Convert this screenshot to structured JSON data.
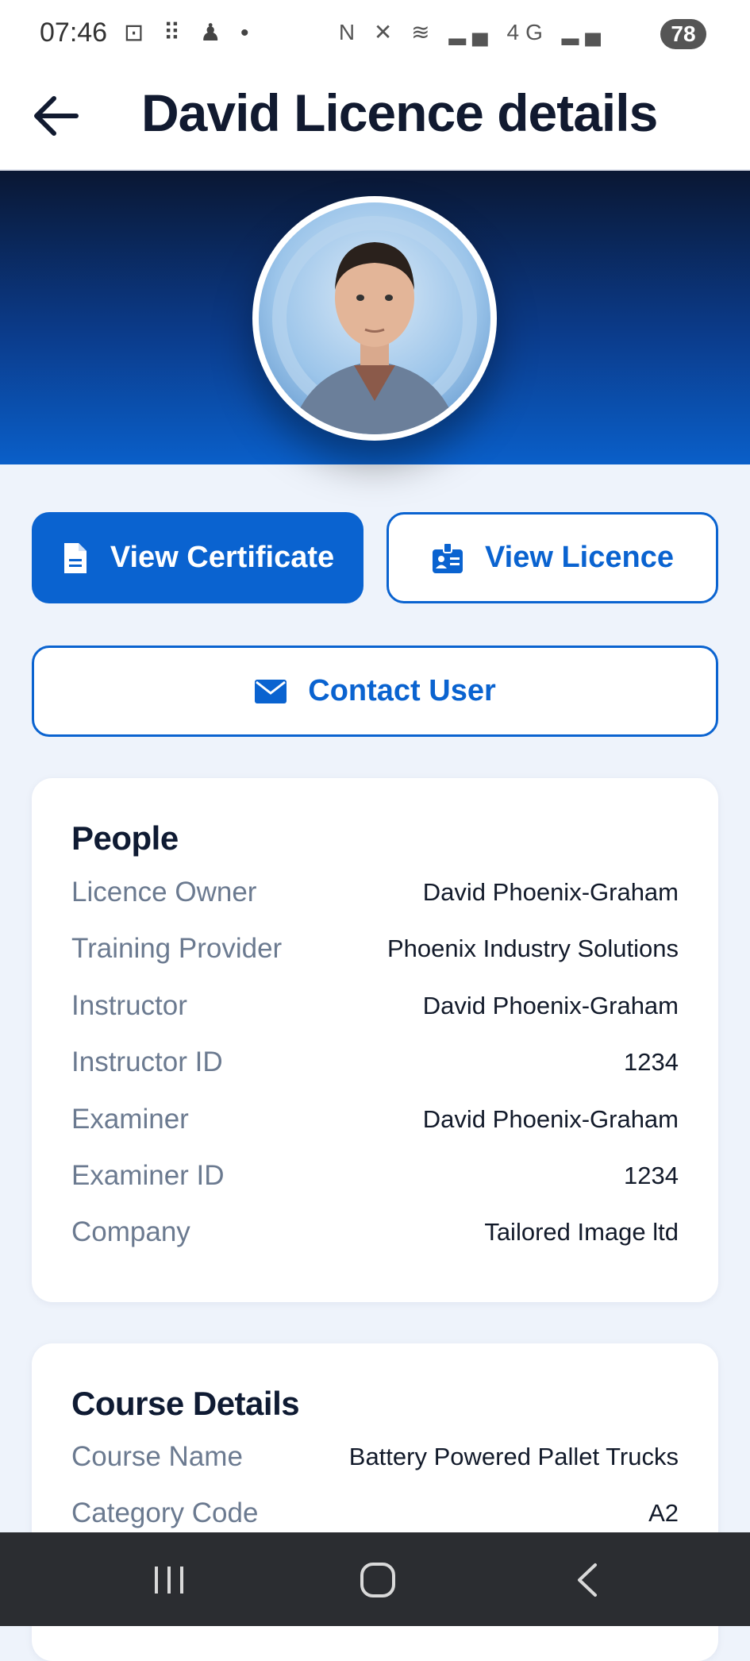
{
  "status_bar": {
    "time": "07:46",
    "left_icons": "⊡ ⠿ ♟ •",
    "right_icons": "N ✕ ≋ ▂▄ 4G ▂▄",
    "battery": "78"
  },
  "header": {
    "title": "David Licence details"
  },
  "colors": {
    "primary": "#0a63d0",
    "hero_top": "#0a1733",
    "hero_bottom": "#0a5fc9"
  },
  "actions": {
    "view_certificate": "View Certificate",
    "view_licence": "View Licence",
    "contact_user": "Contact User"
  },
  "people": {
    "title": "People",
    "rows": [
      {
        "label": "Licence Owner",
        "value": "David Phoenix-Graham"
      },
      {
        "label": "Training Provider",
        "value": "Phoenix Industry Solutions"
      },
      {
        "label": "Instructor",
        "value": "David Phoenix-Graham"
      },
      {
        "label": "Instructor ID",
        "value": "1234"
      },
      {
        "label": "Examiner",
        "value": "David Phoenix-Graham"
      },
      {
        "label": "Examiner ID",
        "value": "1234"
      },
      {
        "label": "Company",
        "value": "Tailored Image ltd"
      }
    ]
  },
  "course": {
    "title": "Course Details",
    "rows": [
      {
        "label": "Course Name",
        "value": "Battery Powered Pallet Trucks"
      },
      {
        "label": "Category Code",
        "value": "A2"
      }
    ]
  },
  "nav": {
    "icons": [
      "recent-apps-icon",
      "home-icon",
      "back-icon"
    ]
  }
}
